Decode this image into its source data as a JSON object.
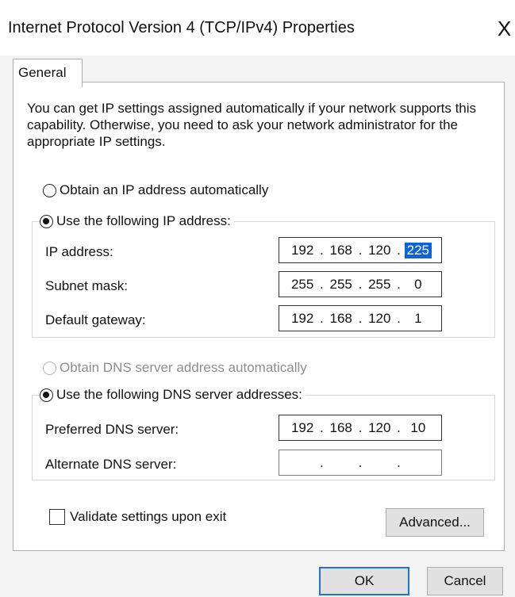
{
  "window": {
    "title": "Internet Protocol Version 4 (TCP/IPv4) Properties",
    "close_glyph": "X"
  },
  "tabs": [
    {
      "label": "General",
      "selected": true
    }
  ],
  "intro_text": "You can get IP settings assigned automatically if your network supports this capability. Otherwise, you need to ask your network administrator for the appropriate IP settings.",
  "ip_mode": {
    "auto_label": "Obtain an IP address automatically",
    "auto_selected": false,
    "manual_label": "Use the following IP address:",
    "manual_selected": true,
    "fields": {
      "ip_address": {
        "label": "IP address:",
        "octets": [
          "192",
          "168",
          "120",
          "225"
        ],
        "selected_octet": 3
      },
      "subnet_mask": {
        "label": "Subnet mask:",
        "octets": [
          "255",
          "255",
          "255",
          "0"
        ]
      },
      "default_gateway": {
        "label": "Default gateway:",
        "octets": [
          "192",
          "168",
          "120",
          "1"
        ]
      }
    }
  },
  "dns_mode": {
    "auto_label": "Obtain DNS server address automatically",
    "auto_selected": false,
    "auto_disabled": true,
    "manual_label": "Use the following DNS server addresses:",
    "manual_selected": true,
    "fields": {
      "preferred": {
        "label": "Preferred DNS server:",
        "octets": [
          "192",
          "168",
          "120",
          "10"
        ]
      },
      "alternate": {
        "label": "Alternate DNS server:",
        "octets": [
          "",
          "",
          "",
          ""
        ]
      }
    }
  },
  "validate": {
    "label": "Validate settings upon exit",
    "checked": false
  },
  "buttons": {
    "advanced": "Advanced...",
    "ok": "OK",
    "cancel": "Cancel"
  },
  "colors": {
    "selection": "#0a64d8",
    "default_button_border": "#1f72d0"
  }
}
